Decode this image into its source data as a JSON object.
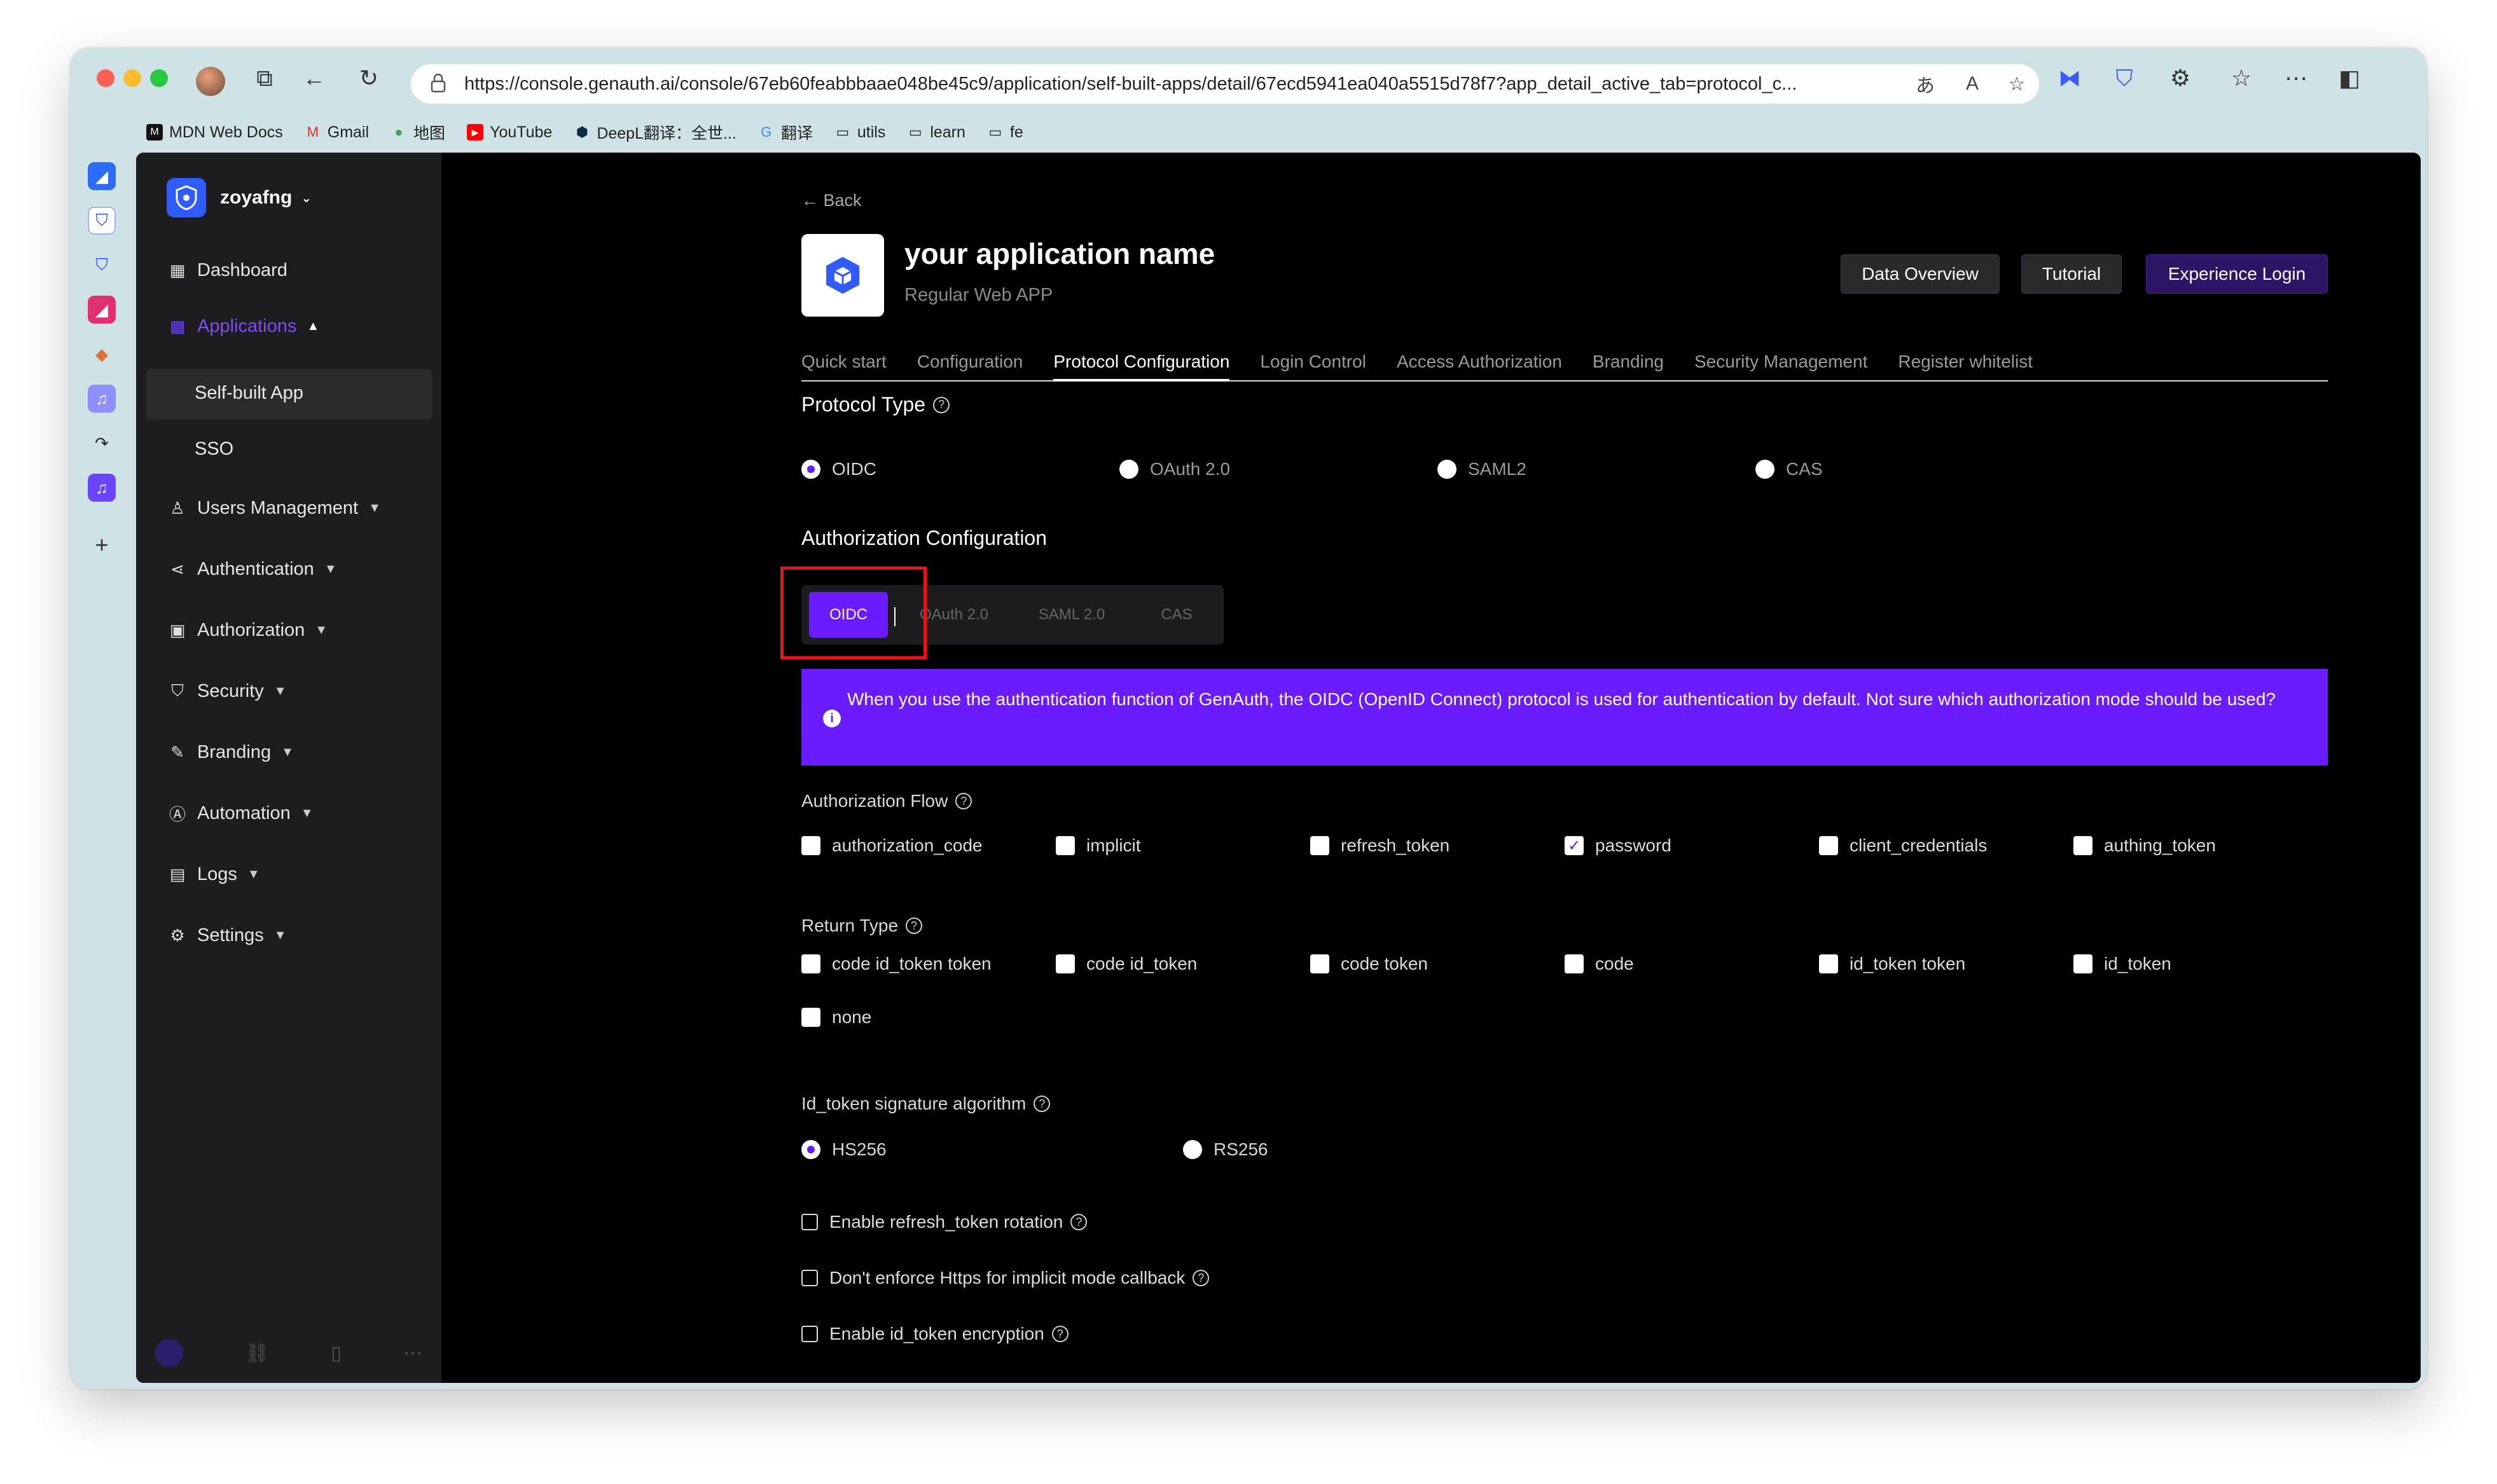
{
  "browser": {
    "url": "https://console.genauth.ai/console/67eb60feabbbaae048be45c9/application/self-built-apps/detail/67ecd5941ea040a5515d78f7?app_detail_active_tab=protocol_c...",
    "bookmarks": [
      "MDN Web Docs",
      "Gmail",
      "地图",
      "YouTube",
      "DeepL翻译：全世...",
      "翻译",
      "utils",
      "learn",
      "fe"
    ]
  },
  "sidebar": {
    "org_name": "zoyafng",
    "items": [
      {
        "label": "Dashboard",
        "icon": "dashboard-icon"
      },
      {
        "label": "Applications",
        "icon": "apps-icon"
      },
      {
        "label": "Self-built App"
      },
      {
        "label": "SSO"
      },
      {
        "label": "Users Management",
        "icon": "user-icon"
      },
      {
        "label": "Authentication",
        "icon": "share-icon"
      },
      {
        "label": "Authorization",
        "icon": "lock-icon"
      },
      {
        "label": "Security",
        "icon": "shield-icon"
      },
      {
        "label": "Branding",
        "icon": "brush-icon"
      },
      {
        "label": "Automation",
        "icon": "automation-icon"
      },
      {
        "label": "Logs",
        "icon": "logs-icon"
      },
      {
        "label": "Settings",
        "icon": "gear-icon"
      }
    ]
  },
  "header": {
    "back": "Back",
    "title": "your application name",
    "subtitle": "Regular Web APP",
    "buttons": {
      "data_overview": "Data Overview",
      "tutorial": "Tutorial",
      "experience": "Experience Login"
    }
  },
  "tabs": [
    "Quick start",
    "Configuration",
    "Protocol Configuration",
    "Login Control",
    "Access Authorization",
    "Branding",
    "Security Management",
    "Register whitelist"
  ],
  "protocol": {
    "title": "Protocol Type",
    "options": [
      "OIDC",
      "OAuth 2.0",
      "SAML2",
      "CAS"
    ],
    "selected": "OIDC"
  },
  "auth_config": {
    "title": "Authorization Configuration",
    "segments": [
      "OIDC",
      "OAuth 2.0",
      "SAML 2.0",
      "CAS"
    ],
    "info": "When you use the authentication function of GenAuth, the OIDC (OpenID Connect) protocol is used for authentication by default. Not sure which authorization mode should be used?"
  },
  "flow": {
    "title": "Authorization Flow",
    "options": [
      "authorization_code",
      "implicit",
      "refresh_token",
      "password",
      "client_credentials",
      "authing_token"
    ],
    "checked": "password"
  },
  "return_type": {
    "title": "Return Type",
    "options": [
      "code id_token token",
      "code id_token",
      "code token",
      "code",
      "id_token token",
      "id_token",
      "none"
    ]
  },
  "signature": {
    "title": "Id_token signature algorithm",
    "options": [
      "HS256",
      "RS256"
    ],
    "selected": "HS256"
  },
  "extra": [
    "Enable refresh_token rotation",
    "Don't enforce Https for implicit mode callback",
    "Enable id_token encryption"
  ],
  "colors": {
    "accent": "#6a1bff",
    "highlight": "#e3141b",
    "background": "#000000",
    "sidebar": "#1d1d1f"
  }
}
